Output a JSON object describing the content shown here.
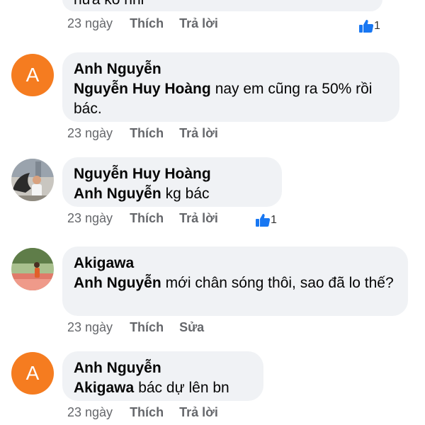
{
  "top": {
    "text": "hứa ko nhỉ",
    "time": "23 ngày",
    "like_label": "Thích",
    "reply_label": "Trả lời",
    "reactions": "1"
  },
  "comments": [
    {
      "avatar_letter": "A",
      "author": "Anh Nguyễn",
      "mention": "Nguyễn Huy Hoàng",
      "text": "nay em cũng ra 50% rồi bác.",
      "time": "23 ngày",
      "like_label": "Thích",
      "action_label": "Trả lời"
    },
    {
      "author": "Nguyễn Huy Hoàng",
      "mention": "Anh Nguyễn",
      "text": "kg bác",
      "time": "23 ngày",
      "like_label": "Thích",
      "action_label": "Trả lời",
      "reactions": "1"
    },
    {
      "author": "Akigawa",
      "mention": "Anh Nguyễn",
      "text": "mới chân sóng thôi, sao đã lo thế?",
      "time": "23 ngày",
      "like_label": "Thích",
      "action_label": "Sửa"
    },
    {
      "avatar_letter": "A",
      "author": "Anh Nguyễn",
      "mention": "Akigawa",
      "text": "bác dự lên bn",
      "time": "23 ngày",
      "like_label": "Thích",
      "action_label": "Trả lời"
    }
  ],
  "colors": {
    "bubble": "#f0f2f5",
    "avatar_orange": "#f57c20",
    "like_blue": "#1877f2",
    "meta_gray": "#65676b"
  }
}
